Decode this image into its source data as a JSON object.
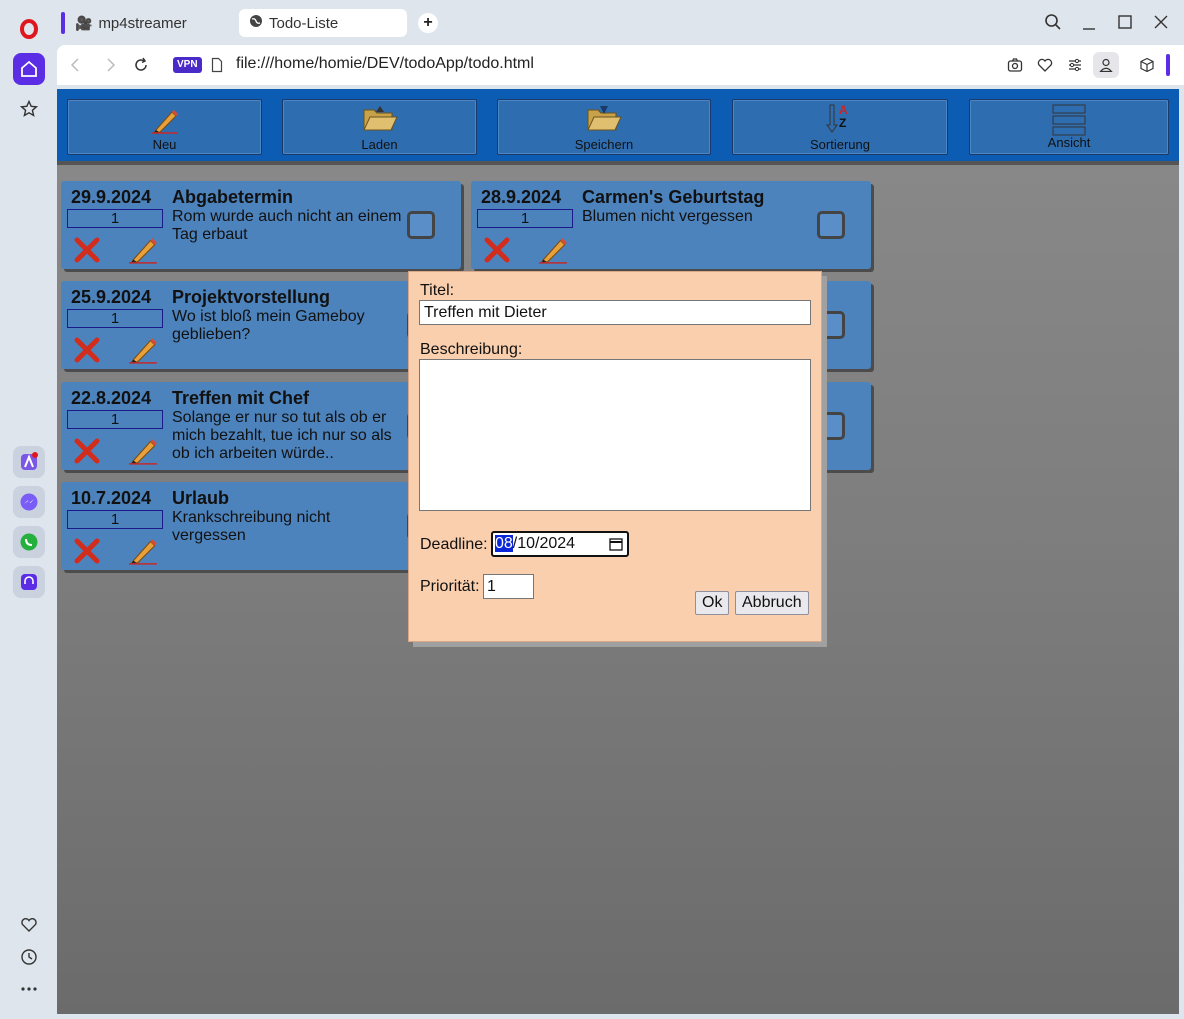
{
  "browser": {
    "tabs": [
      {
        "label": "mp4streamer"
      },
      {
        "label": "Todo-Liste"
      }
    ],
    "vpn_badge": "VPN",
    "url": "file:///home/homie/DEV/todoApp/todo.html",
    "accent_color": "#5b2ee6"
  },
  "toolbar": {
    "new_label": "Neu",
    "load_label": "Laden",
    "save_label": "Speichern",
    "sort_label": "Sortierung",
    "view_label": "Ansicht",
    "sort_icon_top": "A",
    "sort_icon_bottom": "Z"
  },
  "todos": [
    {
      "date": "29.9.2024",
      "priority": "1",
      "title": "Abgabetermin",
      "description": "Rom wurde auch nicht an einem Tag erbaut"
    },
    {
      "date": "28.9.2024",
      "priority": "1",
      "title": "Carmen's Geburtstag",
      "description": "Blumen nicht vergessen"
    },
    {
      "date": "25.9.2024",
      "priority": "1",
      "title": "Projektvorstellung",
      "description": "Wo ist bloß mein Gameboy geblieben?"
    },
    {
      "date": "22.8.2024",
      "priority": "1",
      "title": "Treffen mit Chef",
      "description": "Solange er nur so tut als ob er mich bezahlt, tue ich nur so als ob ich arbeiten würde.."
    },
    {
      "date": "10.7.2024",
      "priority": "1",
      "title": "Urlaub",
      "description": "Krankschreibung nicht vergessen"
    }
  ],
  "dialog": {
    "title_label": "Titel:",
    "title_value": "Treffen mit Dieter",
    "description_label": "Beschreibung:",
    "description_value": "",
    "deadline_label": "Deadline:",
    "deadline_month": "08",
    "deadline_rest": "/10/2024",
    "priority_label": "Priorität:",
    "priority_value": "1",
    "ok_label": "Ok",
    "cancel_label": "Abbruch"
  }
}
